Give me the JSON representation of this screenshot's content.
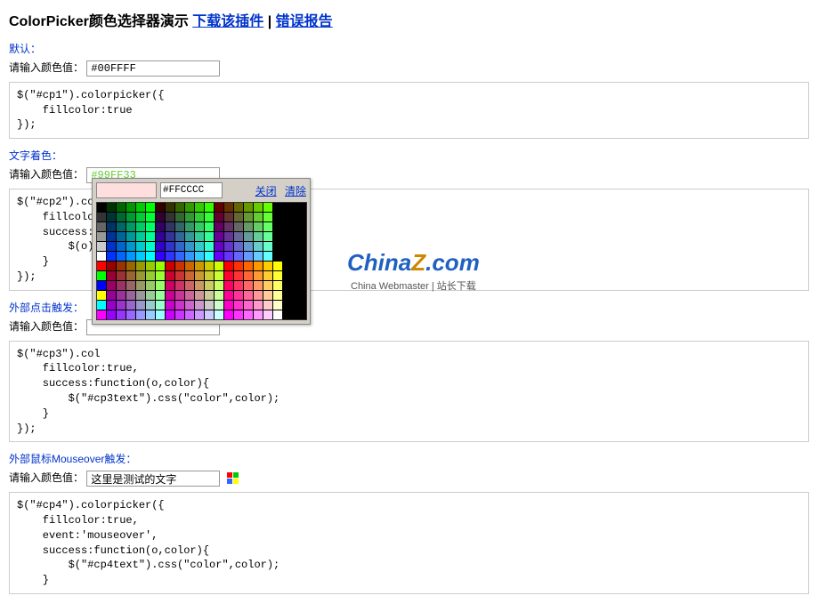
{
  "title": {
    "main": "ColorPicker颜色选择器演示",
    "link_download": "下载该插件",
    "sep": " | ",
    "link_bug": "错误报告"
  },
  "section1": {
    "label": "默认：",
    "input_label": "请输入颜色值：",
    "input_value": "#00FFFF",
    "code": "$(\"#cp1\").colorpicker({\n    fillcolor:true\n});"
  },
  "section2": {
    "label": "文字着色：",
    "input_label": "请输入颜色值：",
    "input_value": "#99FF33",
    "code": "$(\"#cp2\").col\n    fillcolor\n    success:fu\n        $(o).\n    }\n});"
  },
  "picker": {
    "hex": "#FFCCCC",
    "close": "关闭",
    "clear": "清除"
  },
  "section3": {
    "label": "外部点击触发：",
    "input_label": "请输入颜色值：",
    "input_value": "",
    "code": "$(\"#cp3\").col\n    fillcolor:true,\n    success:function(o,color){\n        $(\"#cp3text\").css(\"color\",color);\n    }\n});"
  },
  "section4": {
    "label": "外部鼠标Mouseover触发：",
    "input_label": "请输入颜色值：",
    "input_value": "这里是测试的文字",
    "code": "$(\"#cp4\").colorpicker({\n    fillcolor:true,\n    event:'mouseover',\n    success:function(o,color){\n        $(\"#cp4text\").css(\"color\",color);\n    }"
  },
  "watermark": {
    "brand_chinaz": "China",
    "brand_z": "Z",
    "brand_com": ".com",
    "sub": "China Webmaster | 站长下载"
  },
  "swatch_rows": [
    [
      "#000000",
      "#003300",
      "#006600",
      "#009900",
      "#00CC00",
      "#00FF00",
      "#330000",
      "#333300",
      "#336600",
      "#339900",
      "#33CC00",
      "#33FF00",
      "#660000",
      "#663300",
      "#666600",
      "#669900",
      "#66CC00",
      "#66FF00"
    ],
    [
      "#333333",
      "#003333",
      "#006633",
      "#009933",
      "#00CC33",
      "#00FF33",
      "#330033",
      "#333333",
      "#336633",
      "#339933",
      "#33CC33",
      "#33FF33",
      "#660033",
      "#663333",
      "#666633",
      "#669933",
      "#66CC33",
      "#66FF33"
    ],
    [
      "#666666",
      "#003366",
      "#006666",
      "#009966",
      "#00CC66",
      "#00FF66",
      "#330066",
      "#333366",
      "#336666",
      "#339966",
      "#33CC66",
      "#33FF66",
      "#660066",
      "#663366",
      "#666666",
      "#669966",
      "#66CC66",
      "#66FF66"
    ],
    [
      "#999999",
      "#003399",
      "#006699",
      "#009999",
      "#00CC99",
      "#00FF99",
      "#330099",
      "#333399",
      "#336699",
      "#339999",
      "#33CC99",
      "#33FF99",
      "#660099",
      "#663399",
      "#666699",
      "#669999",
      "#66CC99",
      "#66FF99"
    ],
    [
      "#CCCCCC",
      "#0033CC",
      "#0066CC",
      "#0099CC",
      "#00CCCC",
      "#00FFCC",
      "#3300CC",
      "#3333CC",
      "#3366CC",
      "#3399CC",
      "#33CCCC",
      "#33FFCC",
      "#6600CC",
      "#6633CC",
      "#6666CC",
      "#6699CC",
      "#66CCCC",
      "#66FFCC"
    ],
    [
      "#FFFFFF",
      "#0033FF",
      "#0066FF",
      "#0099FF",
      "#00CCFF",
      "#00FFFF",
      "#3300FF",
      "#3333FF",
      "#3366FF",
      "#3399FF",
      "#33CCFF",
      "#33FFFF",
      "#6600FF",
      "#6633FF",
      "#6666FF",
      "#6699FF",
      "#66CCFF",
      "#66FFFF"
    ],
    [
      "#FF0000",
      "#990000",
      "#993300",
      "#996600",
      "#999900",
      "#99CC00",
      "#99FF00",
      "#CC0000",
      "#CC3300",
      "#CC6600",
      "#CC9900",
      "#CCCC00",
      "#CCFF00",
      "#FF0000",
      "#FF3300",
      "#FF6600",
      "#FF9900",
      "#FFCC00",
      "#FFFF00"
    ],
    [
      "#00FF00",
      "#990033",
      "#993333",
      "#996633",
      "#999933",
      "#99CC33",
      "#99FF33",
      "#CC0033",
      "#CC3333",
      "#CC6633",
      "#CC9933",
      "#CCCC33",
      "#CCFF33",
      "#FF0033",
      "#FF3333",
      "#FF6633",
      "#FF9933",
      "#FFCC33",
      "#FFFF33"
    ],
    [
      "#0000FF",
      "#990066",
      "#993366",
      "#996666",
      "#999966",
      "#99CC66",
      "#99FF66",
      "#CC0066",
      "#CC3366",
      "#CC6666",
      "#CC9966",
      "#CCCC66",
      "#CCFF66",
      "#FF0066",
      "#FF3366",
      "#FF6666",
      "#FF9966",
      "#FFCC66",
      "#FFFF66"
    ],
    [
      "#FFFF00",
      "#990099",
      "#993399",
      "#996699",
      "#999999",
      "#99CC99",
      "#99FF99",
      "#CC0099",
      "#CC3399",
      "#CC6699",
      "#CC9999",
      "#CCCC99",
      "#CCFF99",
      "#FF0099",
      "#FF3399",
      "#FF6699",
      "#FF9999",
      "#FFCC99",
      "#FFFF99"
    ],
    [
      "#00FFFF",
      "#9900CC",
      "#9933CC",
      "#9966CC",
      "#9999CC",
      "#99CCCC",
      "#99FFCC",
      "#CC00CC",
      "#CC33CC",
      "#CC66CC",
      "#CC99CC",
      "#CCCCCC",
      "#CCFFCC",
      "#FF00CC",
      "#FF33CC",
      "#FF66CC",
      "#FF99CC",
      "#FFCCCC",
      "#FFFFCC"
    ],
    [
      "#FF00FF",
      "#9900FF",
      "#9933FF",
      "#9966FF",
      "#9999FF",
      "#99CCFF",
      "#99FFFF",
      "#CC00FF",
      "#CC33FF",
      "#CC66FF",
      "#CC99FF",
      "#CCCCFF",
      "#CCFFFF",
      "#FF00FF",
      "#FF33FF",
      "#FF66FF",
      "#FF99FF",
      "#FFCCFF",
      "#FFFFFF"
    ]
  ]
}
